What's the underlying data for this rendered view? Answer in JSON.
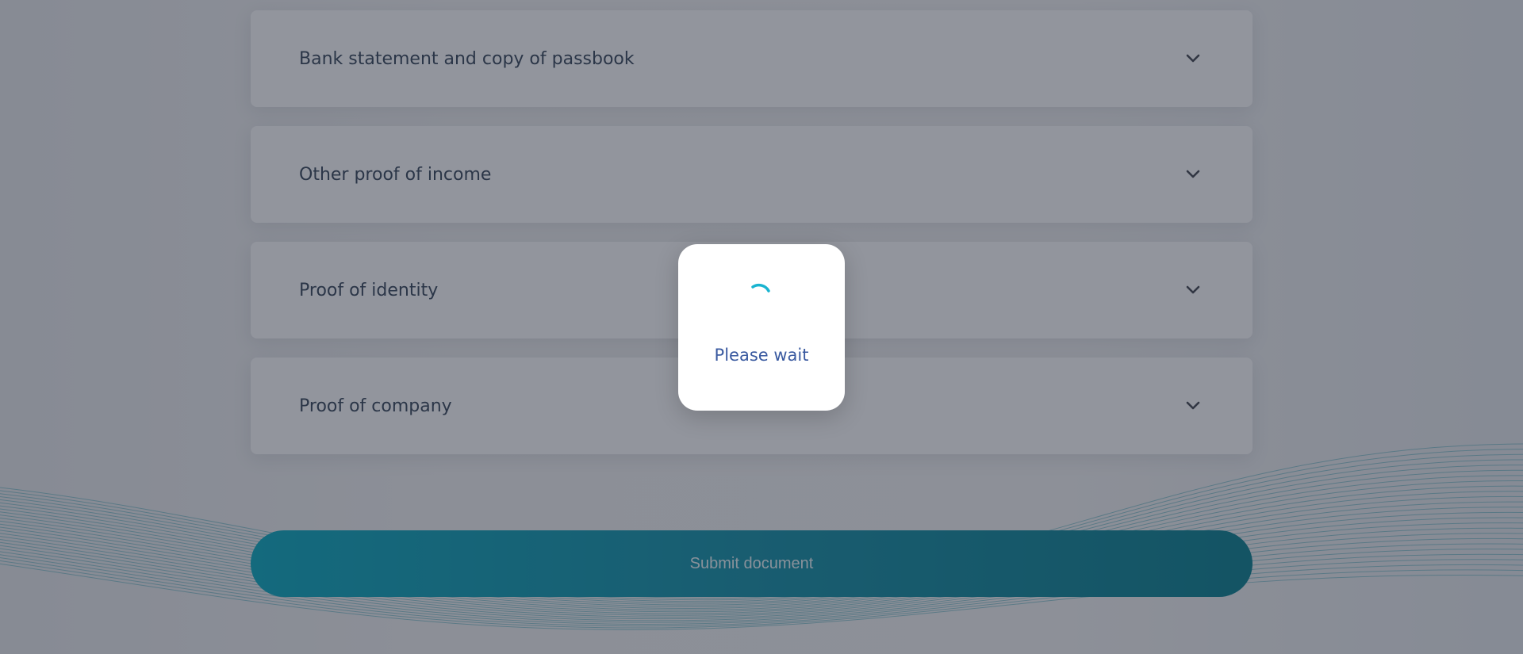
{
  "accordion": {
    "items": [
      {
        "label": "Bank statement and copy of passbook"
      },
      {
        "label": "Other proof of income"
      },
      {
        "label": "Proof of identity"
      },
      {
        "label": "Proof of company"
      }
    ]
  },
  "submit": {
    "label": "Submit document"
  },
  "loader": {
    "text": "Please wait"
  },
  "colors": {
    "accent": "#00a6bd",
    "label_text": "#2f3e52",
    "loader_text": "#3a5aa0"
  },
  "icons": {
    "chevron": "chevron-down-icon",
    "spinner": "spinner-icon"
  }
}
